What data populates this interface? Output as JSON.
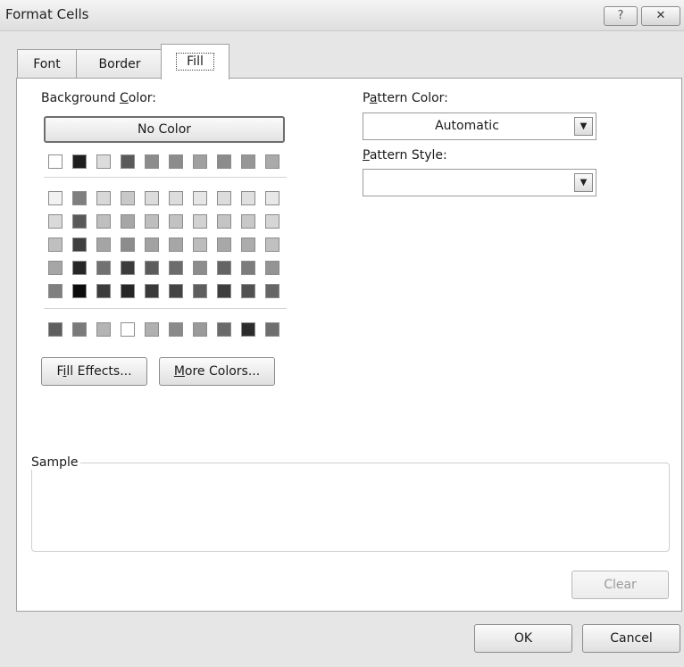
{
  "window": {
    "title": "Format Cells",
    "help_glyph": "?",
    "close_glyph": "✕"
  },
  "tabs": [
    {
      "label": "Font",
      "active": false
    },
    {
      "label": "Border",
      "active": false
    },
    {
      "label": "Fill",
      "active": true
    }
  ],
  "fill": {
    "background_color": {
      "label_pre": "Background ",
      "label_mnemonic": "C",
      "label_post": "olor:",
      "no_color_label": "No Color",
      "theme_row_top": [
        "#ffffff",
        "#1e1e1e",
        "#dcdcdc",
        "#5a5a5a",
        "#8c8c8c",
        "#8c8c8c",
        "#a0a0a0",
        "#8c8c8c",
        "#969696",
        "#aaaaaa"
      ],
      "tints": [
        [
          "#f2f2f2",
          "#7f7f7f",
          "#d8d8d8",
          "#c8c8c8",
          "#dcdcdc",
          "#dcdcdc",
          "#e6e6e6",
          "#dcdcdc",
          "#e0e0e0",
          "#e8e8e8"
        ],
        [
          "#d9d9d9",
          "#595959",
          "#bfbfbf",
          "#a6a6a6",
          "#bebebe",
          "#c2c2c2",
          "#d2d2d2",
          "#c4c4c4",
          "#c8c8c8",
          "#d6d6d6"
        ],
        [
          "#bfbfbf",
          "#3f3f3f",
          "#a5a5a5",
          "#8c8c8c",
          "#a2a2a2",
          "#a6a6a6",
          "#bcbcbc",
          "#a8a8a8",
          "#acacac",
          "#c0c0c0"
        ],
        [
          "#a6a6a6",
          "#262626",
          "#727272",
          "#3c3c3c",
          "#5c5c5c",
          "#6c6c6c",
          "#8c8c8c",
          "#646464",
          "#7c7c7c",
          "#949494"
        ],
        [
          "#7f7f7f",
          "#0c0c0c",
          "#3c3c3c",
          "#262626",
          "#3a3a3a",
          "#444444",
          "#5e5e5e",
          "#3e3e3e",
          "#525252",
          "#666666"
        ]
      ],
      "standard": [
        "#5e5e5e",
        "#7a7a7a",
        "#b4b4b4",
        "#ffffff",
        "#b0b0b0",
        "#8a8a8a",
        "#9a9a9a",
        "#6a6a6a",
        "#2c2c2c",
        "#6e6e6e"
      ]
    },
    "fill_effects_button": {
      "pre": "F",
      "mnemonic": "i",
      "post": "ll Effects..."
    },
    "more_colors_button": {
      "pre": "",
      "mnemonic": "M",
      "post": "ore Colors..."
    },
    "pattern_color": {
      "label_pre": "P",
      "label_mnemonic": "a",
      "label_post": "ttern Color:",
      "value": "Automatic"
    },
    "pattern_style": {
      "label_pre": "",
      "label_mnemonic": "P",
      "label_post": "attern Style:",
      "value": ""
    },
    "dropdown_glyph": "▼",
    "sample_label": "Sample",
    "clear_button": "Clear"
  },
  "footer": {
    "ok_label": "OK",
    "cancel_label": "Cancel"
  }
}
